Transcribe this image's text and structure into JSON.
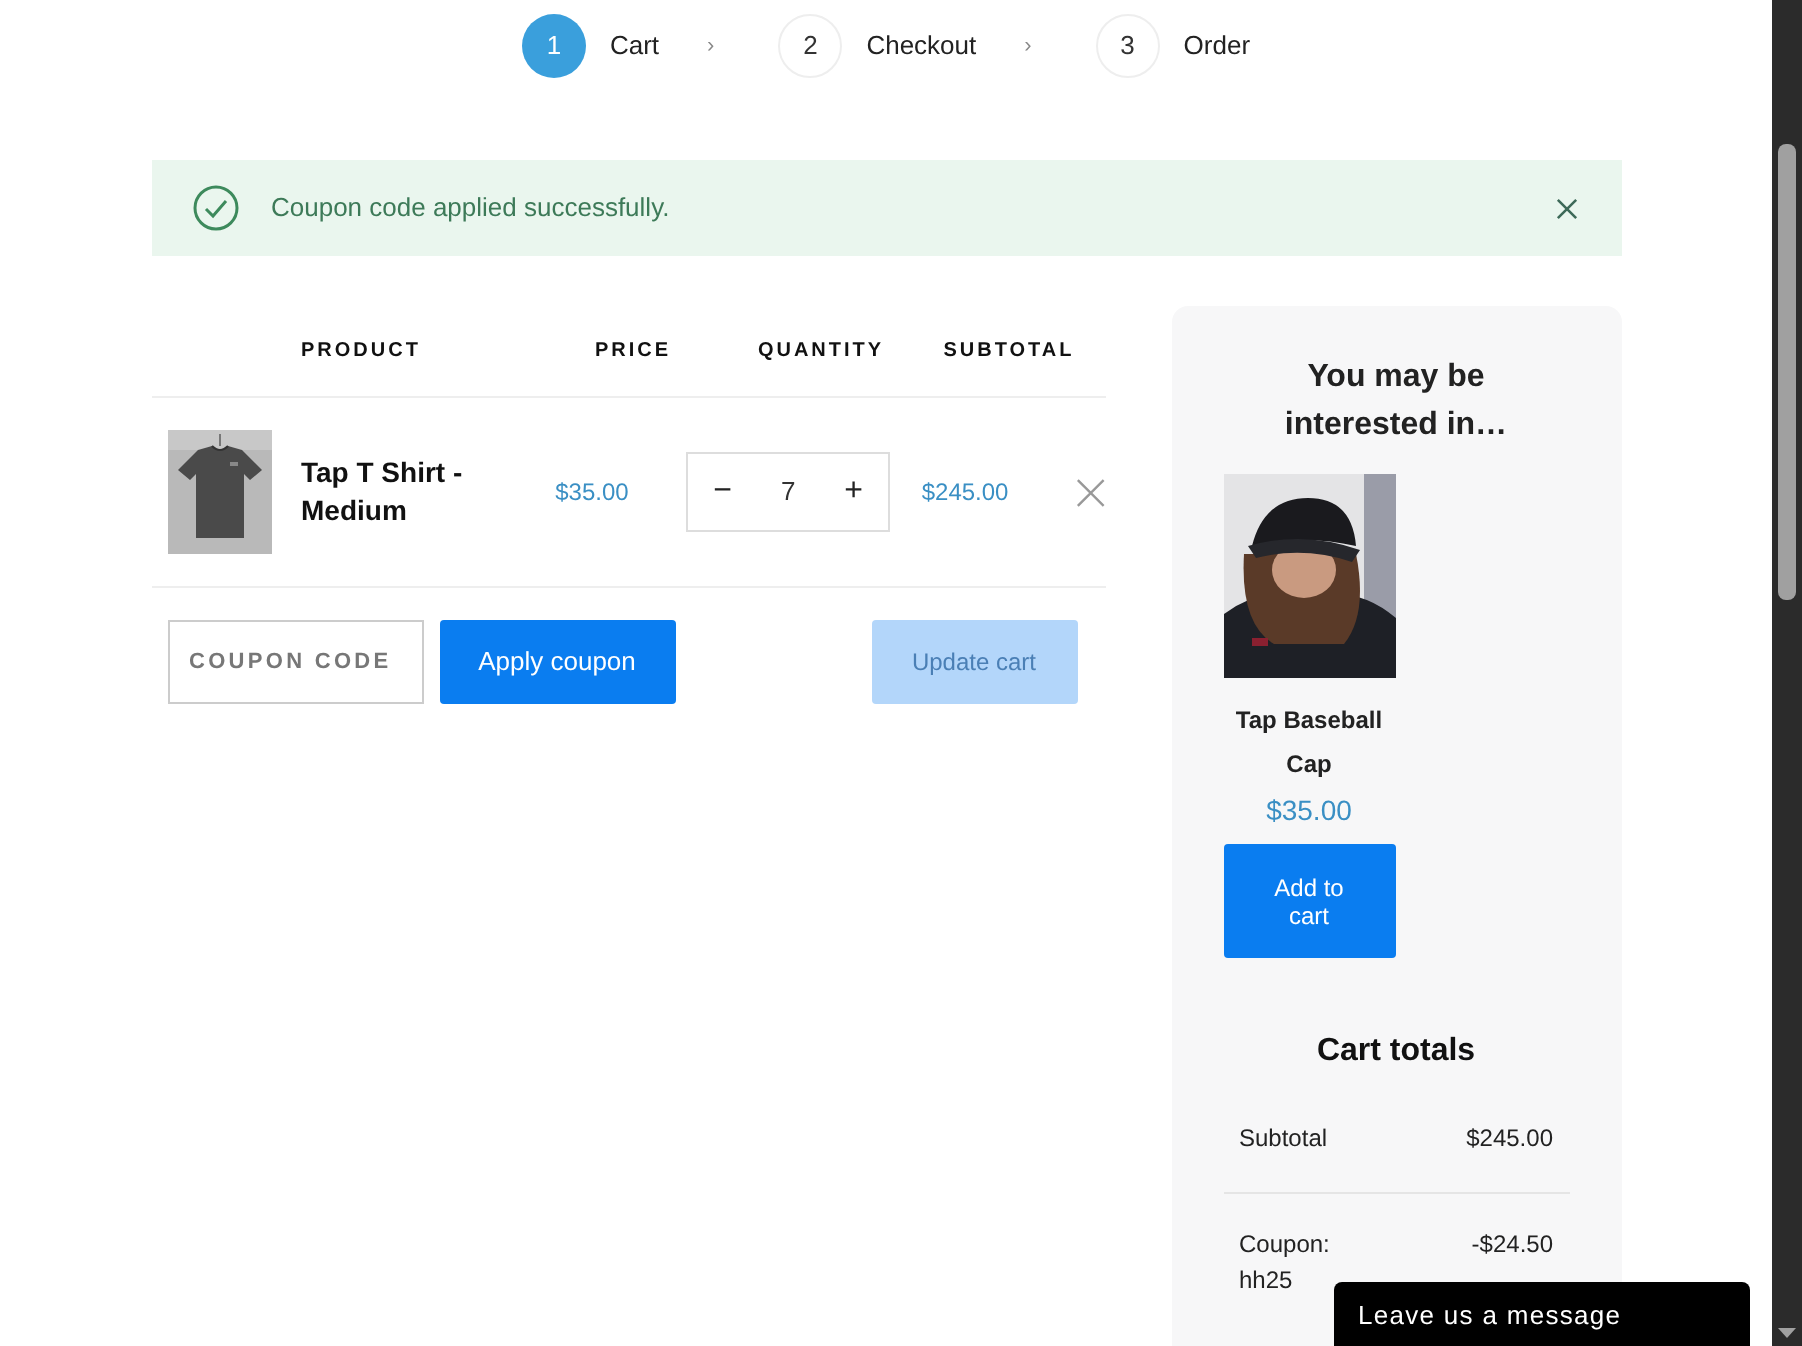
{
  "steps": [
    {
      "number": "1",
      "label": "Cart",
      "selected": true,
      "separator": "›"
    },
    {
      "number": "2",
      "label": "Checkout",
      "selected": false,
      "separator": "›"
    },
    {
      "number": "3",
      "label": "Order",
      "selected": false
    }
  ],
  "notice": {
    "message": "Coupon code applied successfully."
  },
  "cart": {
    "columns": [
      "PRODUCT",
      "PRICE",
      "QUANTITY",
      "SUBTOTAL"
    ],
    "rows": [
      {
        "name": "Tap T Shirt - Medium",
        "price": "$35.00",
        "quantity": "7",
        "minus": "−",
        "plus": "+",
        "subtotal": "$245.00"
      }
    ],
    "coupon": {
      "placeholder": "COUPON CODE"
    },
    "apply_button": "Apply coupon",
    "update_button": {
      "label": "Update cart",
      "disabled": true
    }
  },
  "sidebar": {
    "title": "You may be interested in…",
    "products": [
      {
        "name": "Tap Baseball Cap",
        "price": "$35.00",
        "button": "Add to cart"
      }
    ],
    "totals_title": "Cart totals",
    "totals": [
      {
        "label": "Subtotal",
        "value": "$245.00"
      },
      {
        "label": "Coupon: hh25",
        "value": "-$24.50"
      }
    ]
  },
  "chat": {
    "label": "Leave us a message"
  }
}
